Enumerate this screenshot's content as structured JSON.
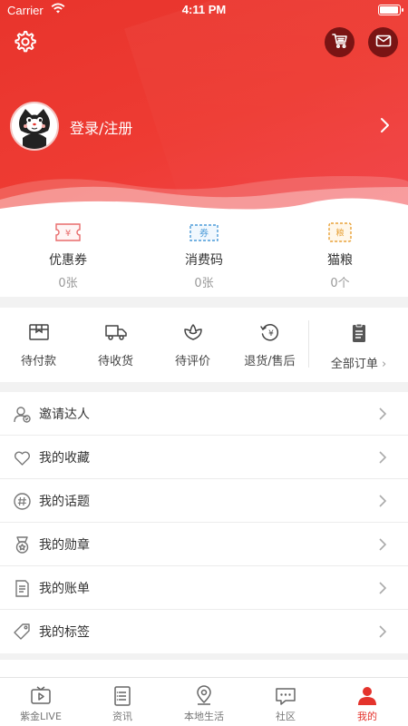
{
  "status_bar": {
    "carrier": "Carrier",
    "time": "4:11 PM",
    "battery_level": 1.0
  },
  "header": {
    "settings_icon": "gear-icon",
    "cart_icon": "cart-icon",
    "mail_icon": "mail-icon",
    "login_label": "登录/注册"
  },
  "assets": [
    {
      "icon": "coupon-icon",
      "label": "优惠券",
      "value": "0张",
      "color": "#e86c6c"
    },
    {
      "icon": "voucher-code-icon",
      "label": "消费码",
      "value": "0张",
      "color": "#4a9ad8"
    },
    {
      "icon": "cat-food-icon",
      "label": "猫粮",
      "value": "0个",
      "color": "#e8a23a"
    }
  ],
  "orders": [
    {
      "icon": "wallet-icon",
      "label": "待付款"
    },
    {
      "icon": "truck-icon",
      "label": "待收货"
    },
    {
      "icon": "review-icon",
      "label": "待评价"
    },
    {
      "icon": "refund-icon",
      "label": "退货/售后"
    },
    {
      "icon": "clipboard-icon",
      "label": "全部订单"
    }
  ],
  "menu": [
    {
      "icon": "invite-user-icon",
      "label": "邀请达人"
    },
    {
      "icon": "heart-icon",
      "label": "我的收藏"
    },
    {
      "icon": "hashtag-icon",
      "label": "我的话题"
    },
    {
      "icon": "medal-icon",
      "label": "我的勋章"
    },
    {
      "icon": "bill-icon",
      "label": "我的账单"
    },
    {
      "icon": "tag-icon",
      "label": "我的标签"
    }
  ],
  "tabbar": [
    {
      "icon": "tv-play-icon",
      "label": "紫金LIVE",
      "active": false
    },
    {
      "icon": "news-list-icon",
      "label": "资讯",
      "active": false
    },
    {
      "icon": "location-pin-icon",
      "label": "本地生活",
      "active": false
    },
    {
      "icon": "chat-bubble-icon",
      "label": "社区",
      "active": false
    },
    {
      "icon": "person-icon",
      "label": "我的",
      "active": true
    }
  ],
  "colors": {
    "brand_red": "#e4332c",
    "header_red": "#ee3b33",
    "text": "#333333",
    "muted": "#999999"
  }
}
